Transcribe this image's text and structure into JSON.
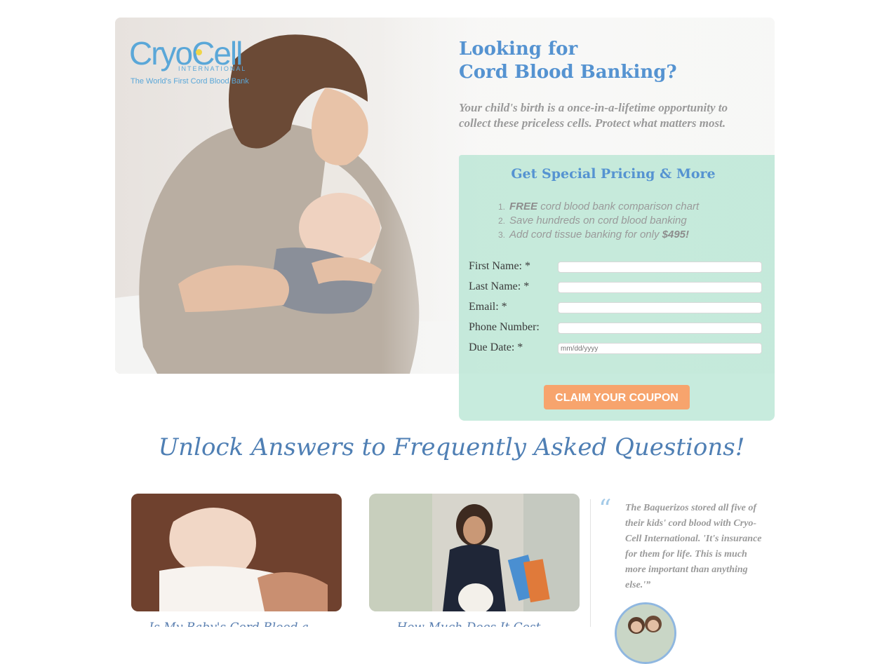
{
  "logo": {
    "wordmark": "CryoCell",
    "sub": "INTERNATIONAL",
    "tagline": "The World's First Cord Blood Bank"
  },
  "hero": {
    "headline_line1": "Looking for",
    "headline_line2": "Cord Blood Banking?",
    "subhead": "Your child's birth is a once-in-a-lifetime opportunity to collect these priceless cells. Protect what matters most."
  },
  "form": {
    "title": "Get Special Pricing & More",
    "benefits": [
      {
        "num": "1.",
        "bold": "FREE",
        "text": " cord blood bank comparison chart",
        "bold_after": ""
      },
      {
        "num": "2.",
        "bold": "",
        "text": "Save hundreds on cord blood banking",
        "bold_after": ""
      },
      {
        "num": "3.",
        "bold": "",
        "text": "Add cord tissue banking for only ",
        "bold_after": "$495!"
      }
    ],
    "fields": [
      {
        "label": "First Name: *",
        "placeholder": ""
      },
      {
        "label": "Last Name: *",
        "placeholder": ""
      },
      {
        "label": "Email: *",
        "placeholder": ""
      },
      {
        "label": "Phone Number:",
        "placeholder": ""
      },
      {
        "label": "Due Date: *",
        "placeholder": "mm/dd/yyyy"
      }
    ],
    "cta_label": "CLAIM YOUR COUPON"
  },
  "faq": {
    "title": "Unlock Answers to Frequently Asked Questions!",
    "cards": [
      {
        "caption": "Is My Baby's Cord Blood a ..."
      },
      {
        "caption": "How Much Does It Cost..."
      }
    ]
  },
  "testimonial": {
    "quote_mark": "“",
    "text": "The Baquerizos stored all five of their kids' cord blood with Cryo-Cell International. 'It's insurance for them for life. This is much more important than anything else.'”"
  },
  "colors": {
    "brand_blue": "#5593d1",
    "form_bg": "#b7e5d4",
    "cta": "#f7a46d",
    "logo_dot": "#f0d548"
  }
}
